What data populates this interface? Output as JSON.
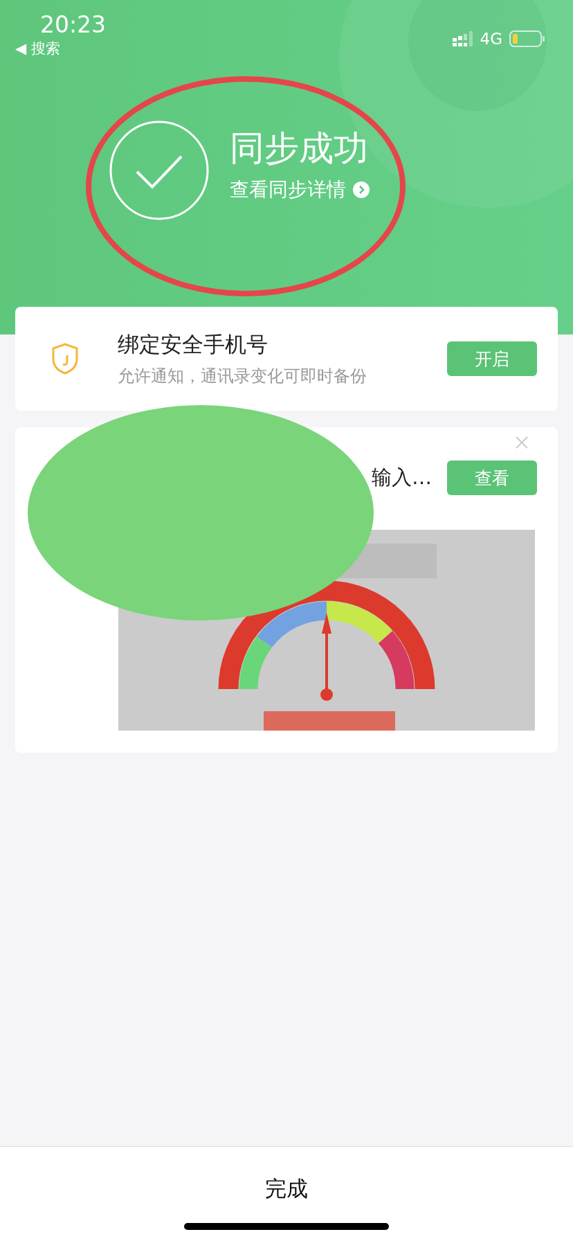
{
  "status_bar": {
    "time": "20:23",
    "back_label": "◀ 搜索",
    "network": "4G"
  },
  "sync": {
    "title": "同步成功",
    "link": "查看同步详情"
  },
  "cards": [
    {
      "kind": "bind",
      "title": "绑定安全手机号",
      "subtitle": "允许通知，通讯录变化可即时备份",
      "button": "开启"
    },
    {
      "kind": "ad",
      "title": "输入…",
      "button": "查看",
      "closable": true
    }
  ],
  "footer": {
    "button": "完成"
  },
  "markup": {
    "ring": true,
    "blot": true
  }
}
